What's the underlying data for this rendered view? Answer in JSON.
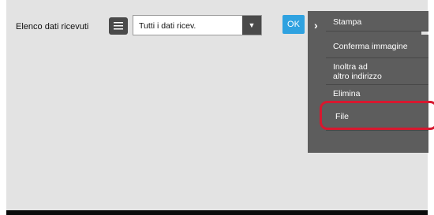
{
  "header": {
    "title": "Elenco dati ricevuti",
    "select_value": "Tutti i dati ricev.",
    "ok_label": "OK"
  },
  "menu": {
    "items": [
      {
        "label": "Stampa"
      },
      {
        "label": "Conferma immagine"
      },
      {
        "label": "Inoltra ad\naltro indirizzo"
      },
      {
        "label": "Elimina"
      },
      {
        "label": "File"
      }
    ]
  },
  "icons": {
    "list": "list-icon",
    "dropdown": "triangle-down-icon",
    "chevron": "chevron-right-icon"
  },
  "colors": {
    "ok_button": "#2fa2e0",
    "menu_background": "#5d5d5d",
    "highlight": "#d7182f"
  }
}
